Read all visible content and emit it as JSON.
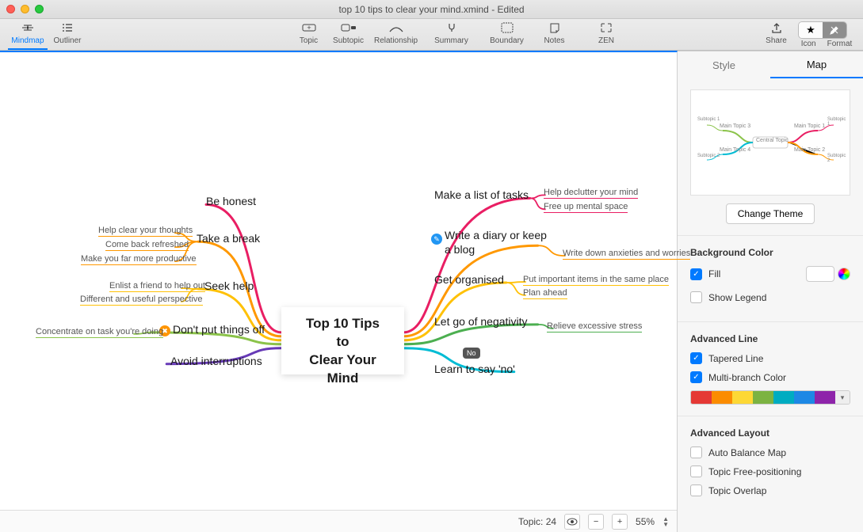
{
  "window": {
    "title": "top 10 tips to clear your mind.xmind - Edited"
  },
  "toolbar": {
    "views": [
      {
        "id": "mindmap",
        "label": "Mindmap",
        "active": true
      },
      {
        "id": "outliner",
        "label": "Outliner",
        "active": false
      }
    ],
    "tools": [
      {
        "id": "topic",
        "label": "Topic"
      },
      {
        "id": "subtopic",
        "label": "Subtopic"
      },
      {
        "id": "relationship",
        "label": "Relationship"
      },
      {
        "id": "summary",
        "label": "Summary"
      },
      {
        "id": "boundary",
        "label": "Boundary"
      },
      {
        "id": "notes",
        "label": "Notes"
      }
    ],
    "zen": {
      "label": "ZEN"
    },
    "share": {
      "label": "Share"
    },
    "icon": {
      "label": "Icon"
    },
    "format": {
      "label": "Format"
    }
  },
  "mindmap": {
    "central": "Top 10 Tips\nto\nClear Your Mind",
    "left_branches": [
      {
        "label": "Be honest",
        "subs": []
      },
      {
        "label": "Take a break",
        "subs": [
          "Help clear your thoughts",
          "Come back refreshed",
          "Make you far more productive"
        ]
      },
      {
        "label": "Seek help",
        "subs": [
          "Enlist a friend to help out",
          "Different and useful perspective"
        ]
      },
      {
        "label": "Don't put things off",
        "marker": "orange",
        "marker_text": "✖",
        "subs": [
          "Concentrate on task you're doing"
        ]
      },
      {
        "label": "Avoid interruptions",
        "subs": []
      }
    ],
    "right_branches": [
      {
        "label": "Make a list of tasks",
        "subs": [
          "Help declutter your mind",
          "Free up mental space"
        ]
      },
      {
        "label": "Write a diary or keep\na blog",
        "marker": "blue",
        "marker_text": "✎",
        "subs": [
          "Write down anxieties and worries"
        ]
      },
      {
        "label": "Get organised",
        "subs": [
          "Put important items in the same place",
          "Plan ahead"
        ]
      },
      {
        "label": "Let go of negativity",
        "subs": [
          "Relieve excessive stress"
        ]
      },
      {
        "label": "Learn to say 'no'",
        "tag": "No",
        "subs": []
      }
    ]
  },
  "panel": {
    "tabs": {
      "style": "Style",
      "map": "Map"
    },
    "change_theme": "Change Theme",
    "bg_header": "Background Color",
    "fill_label": "Fill",
    "show_legend": "Show Legend",
    "adv_line_header": "Advanced Line",
    "tapered": "Tapered Line",
    "multi_branch": "Multi-branch Color",
    "adv_layout_header": "Advanced Layout",
    "auto_balance": "Auto Balance Map",
    "free_pos": "Topic Free-positioning",
    "overlap": "Topic Overlap",
    "preview_central": "Central Topic",
    "preview_nodes": {
      "l1": "Main Topic 3",
      "l2": "Main Topic 4",
      "r1": "Main Topic 1",
      "r2": "Main Topic 2",
      "s1": "Subtopic 1",
      "s2": "Subtopic 2",
      "s3": "Subtopic 1",
      "s4": "Subtopic 2"
    }
  },
  "footer": {
    "topic_count_label": "Topic: 24",
    "zoom": "55%"
  },
  "colors": {
    "branches": [
      "#e91e63",
      "#ff9800",
      "#ffc107",
      "#8bc34a",
      "#4caf50",
      "#00bcd4",
      "#2196f3",
      "#3f51b5",
      "#9c27b0",
      "#673ab7"
    ]
  }
}
